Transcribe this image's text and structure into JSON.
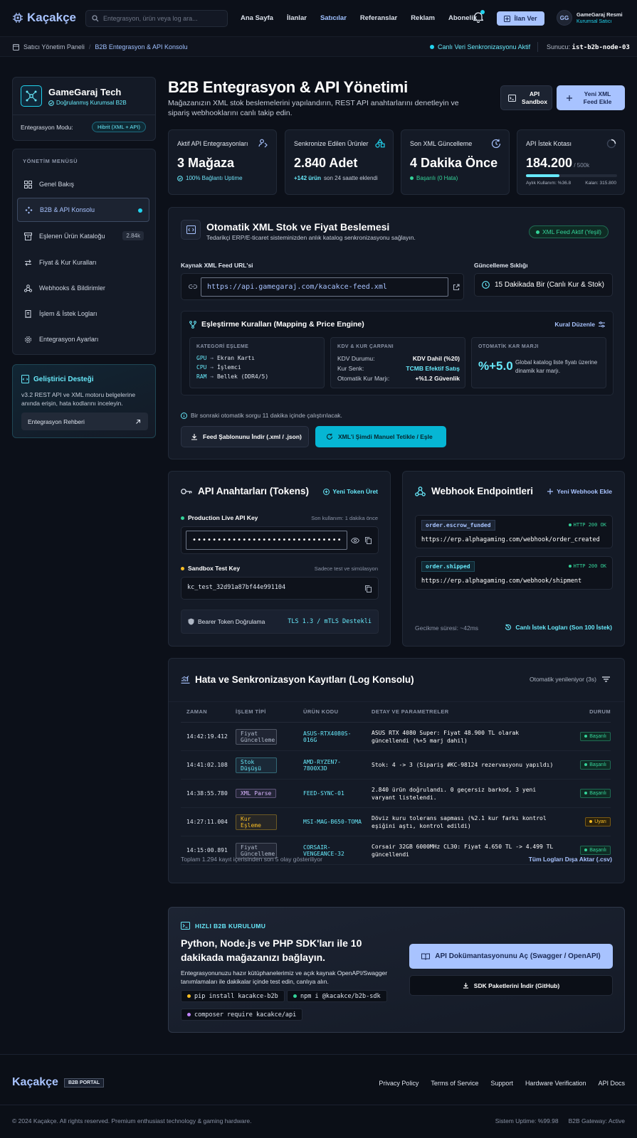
{
  "brand": {
    "name": "Kaçakçe",
    "footer_badge": "B2B PORTAL"
  },
  "nav": {
    "search_placeholder": "Entegrasyon, ürün veya log ara...",
    "links": [
      "Ana Sayfa",
      "İlanlar",
      "Satıcılar",
      "Referanslar",
      "Reklam",
      "Abonelik"
    ],
    "active": "Satıcılar",
    "post_button": "İlan Ver",
    "user": {
      "initials": "GG",
      "name": "GameGaraj Resmi",
      "role": "Kurumsal Satıcı"
    }
  },
  "breadcrumb": {
    "root": "Satıcı Yönetim Paneli",
    "current": "B2B Entegrasyon & API Konsolu",
    "live_status": "Canlı Veri Senkronizasyonu Aktif",
    "server_label": "Sunucu:",
    "server_value": "ist-b2b-node-03"
  },
  "sidebar": {
    "company": "GameGaraj Tech",
    "verified": "Doğrulanmış Kurumsal B2B",
    "mode_label": "Entegrasyon Modu:",
    "mode_value": "Hibrit (XML + API)",
    "menu_title": "YÖNETİM MENÜSÜ",
    "items": [
      {
        "label": "Genel Bakış",
        "icon": "grid-icon"
      },
      {
        "label": "B2B & API Konsolu",
        "icon": "api-icon",
        "active": true
      },
      {
        "label": "Eşlenen Ürün Kataloğu",
        "icon": "archive-icon",
        "badge": "2.84k"
      },
      {
        "label": "Fiyat & Kur Kuralları",
        "icon": "swap-icon"
      },
      {
        "label": "Webhooks & Bildirimler",
        "icon": "webhook-icon"
      },
      {
        "label": "İşlem & İstek Logları",
        "icon": "receipt-icon"
      },
      {
        "label": "Entegrasyon Ayarları",
        "icon": "gear-icon"
      }
    ],
    "dev": {
      "title": "Geliştirici Desteği",
      "text": "v3.2 REST API ve XML motoru belgelerine anında erişin, hata kodlarını inceleyin.",
      "button": "Entegrasyon Rehberi"
    }
  },
  "header": {
    "title": "B2B Entegrasyon & API Yönetimi",
    "subtitle": "Mağazanızın XML stok beslemelerini yapılandırın, REST API anahtarlarını denetleyin ve sipariş webhooklarını canlı takip edin.",
    "sandbox_button": "API Sandbox",
    "new_feed_button": "Yeni XML Feed Ekle"
  },
  "stats": [
    {
      "label": "Aktif API Entegrasyonları",
      "value": "3 Mağaza",
      "sub": "100% Bağlantı Uptime"
    },
    {
      "label": "Senkronize Edilen Ürünler",
      "value": "2.840 Adet",
      "sub_strong": "+142 ürün",
      "sub": "son 24 saatte eklendi"
    },
    {
      "label": "Son XML Güncelleme",
      "value": "4 Dakika Önce",
      "sub": "Başarılı (0 Hata)"
    },
    {
      "label": "API İstek Kotası",
      "value": "184.200",
      "value_suffix": "/ 500k",
      "quota_fraction": 0.368,
      "quota_used": "Aylık Kullanım: %36.8",
      "quota_left": "Kalan: 315.800"
    }
  ],
  "xml": {
    "title": "Otomatik XML Stok ve Fiyat Beslemesi",
    "subtitle": "Tedarikçi ERP/E-ticaret sisteminizden anlık katalog senkronizasyonu sağlayın.",
    "status": "XML Feed Aktif (Yeşil)",
    "url_label": "Kaynak XML Feed URL'si",
    "url_value": "https://api.gamegaraj.com/kacakce-feed.xml",
    "freq_label": "Güncelleme Sıklığı",
    "freq_value": "15 Dakikada Bir (Canlı Kur & Stok)",
    "mapping": {
      "title": "Eşleştirme Kuralları (Mapping & Price Engine)",
      "edit": "Kural Düzenle",
      "cat_title": "KATEGORİ EŞLEME",
      "cats": [
        {
          "from": "GPU",
          "to": "Ekran Kartı"
        },
        {
          "from": "CPU",
          "to": "İşlemci"
        },
        {
          "from": "RAM",
          "to": "Bellek (DDR4/5)"
        }
      ],
      "kdv_title": "KDV & KUR ÇARPANI",
      "kdv": [
        {
          "k": "KDV Durumu:",
          "v": "KDV Dahil (%20)"
        },
        {
          "k": "Kur Senk:",
          "v": "TCMB Efektif Satış"
        },
        {
          "k": "Otomatik Kur Marjı:",
          "v": "+%1.2 Güvenlik"
        }
      ],
      "margin_title": "OTOMATİK KAR MARJI",
      "margin_value": "%+5.0",
      "margin_text": "Global katalog liste fiyatı üzerine dinamik kar marjı."
    },
    "next_query": "Bir sonraki otomatik sorgu 11 dakika içinde çalıştırılacak.",
    "download_button": "Feed Şablonunu İndir (.xml / .json)",
    "trigger_button": "XML'i Şimdi Manuel Tetikle / Eşle"
  },
  "api_keys": {
    "title": "API Anahtarları (Tokens)",
    "new_token": "Yeni Token Üret",
    "prod_label": "Production Live API Key",
    "prod_meta": "Son kullanım: 1 dakika önce",
    "prod_value": "••••••••••••••••••••••••••••••",
    "sandbox_label": "Sandbox Test Key",
    "sandbox_meta": "Sadece test ve simülasyon",
    "sandbox_value": "kc_test_32d91a87bf44e991104",
    "bearer": "Bearer Token Doğrulama",
    "tls": "TLS 1.3 / mTLS Destekli"
  },
  "webhooks": {
    "title": "Webhook Endpointleri",
    "new": "Yeni Webhook Ekle",
    "items": [
      {
        "event": "order.escrow_funded",
        "status": "HTTP 200 OK",
        "url": "https://erp.alphagaming.com/webhook/order_created"
      },
      {
        "event": "order.shipped",
        "status": "HTTP 200 OK",
        "url": "https://erp.alphagaming.com/webhook/shipment"
      }
    ],
    "latency": "Gecikme süresi: ~42ms",
    "logs_link": "Canlı İstek Logları (Son 100 İstek)"
  },
  "logs": {
    "title": "Hata ve Senkronizasyon Kayıtları (Log Konsolu)",
    "refresh": "Otomatik yenileniyor (3s)",
    "columns": [
      "ZAMAN",
      "İŞLEM TİPİ",
      "ÜRÜN KODU",
      "DETAY VE PARAMETRELER",
      "DURUM"
    ],
    "rows": [
      {
        "time": "14:42:19.412",
        "type": "Fiyat Güncelleme",
        "type_color": "#aeb8c8",
        "code": "ASUS-RTX4080S-016G",
        "detail": "ASUS RTX 4080 Super: Fiyat 48.900 TL olarak güncellendi (%+5 marj dahil)",
        "status": "Başarılı",
        "ok": true
      },
      {
        "time": "14:41:02.108",
        "type": "Stok Düşüşü",
        "type_color": "#67e8f9",
        "code": "AMD-RYZEN7-7800X3D",
        "detail": "Stok: 4 -> 3 (Sipariş #KC-98124 rezervasyonu yapıldı)",
        "status": "Başarılı",
        "ok": true
      },
      {
        "time": "14:38:55.780",
        "type": "XML Parse",
        "type_color": "#d8b4fe",
        "code": "FEED-SYNC-01",
        "detail": "2.840 ürün doğrulandı. 0 geçersiz barkod, 3 yeni varyant listelendi.",
        "status": "Başarılı",
        "ok": true
      },
      {
        "time": "14:27:11.004",
        "type": "Kur Eşleme",
        "type_color": "#fbbf24",
        "code": "MSI-MAG-B650-TOMA",
        "detail": "Döviz kuru tolerans sapması (%2.1 kur farkı kontrol eşiğini aştı, kontrol edildi)",
        "status": "Uyarı",
        "ok": false
      },
      {
        "time": "14:15:00.891",
        "type": "Fiyat Güncelleme",
        "type_color": "#aeb8c8",
        "code": "CORSAIR-VENGEANCE-32",
        "detail": "Corsair 32GB 6000MHz CL30: Fiyat 4.650 TL -> 4.499 TL güncellendi",
        "status": "Başarılı",
        "ok": true
      }
    ],
    "summary": "Toplam 1.294 kayıt içerisinden son 5 olay gösteriliyor",
    "export": "Tüm Logları Dışa Aktar (.csv)"
  },
  "quick": {
    "kicker": "HIZLI B2B KURULUMU",
    "title": "Python, Node.js ve PHP SDK'ları ile 10 dakikada mağazanızı bağlayın.",
    "text": "Entegrasyonunuzu hazır kütüphanelerimiz ve açık kaynak OpenAPI/Swagger tanımlamaları ile dakikalar içinde test edin, canlıya alın.",
    "cmds": [
      "pip install kacakce-b2b",
      "npm i @kacakce/b2b-sdk",
      "composer require kacakce/api"
    ],
    "docs_button": "API Dokümantasyonunu Aç (Swagger / OpenAPI)",
    "sdk_button": "SDK Paketlerini İndir (GitHub)"
  },
  "footer": {
    "links": [
      "Privacy Policy",
      "Terms of Service",
      "Support",
      "Hardware Verification",
      "API Docs"
    ],
    "copyright": "© 2024 Kaçakçe. All rights reserved. Premium enthusiast technology & gaming hardware.",
    "uptime": "Sistem Uptime: %99.98",
    "gateway": "B2B Gateway: Active"
  },
  "colors": {
    "accent": "#a8c3ff",
    "cyan": "#22d3ee",
    "success": "#34d399",
    "warning": "#fbbf24",
    "bg": "#0c1019",
    "card": "#141a26"
  }
}
